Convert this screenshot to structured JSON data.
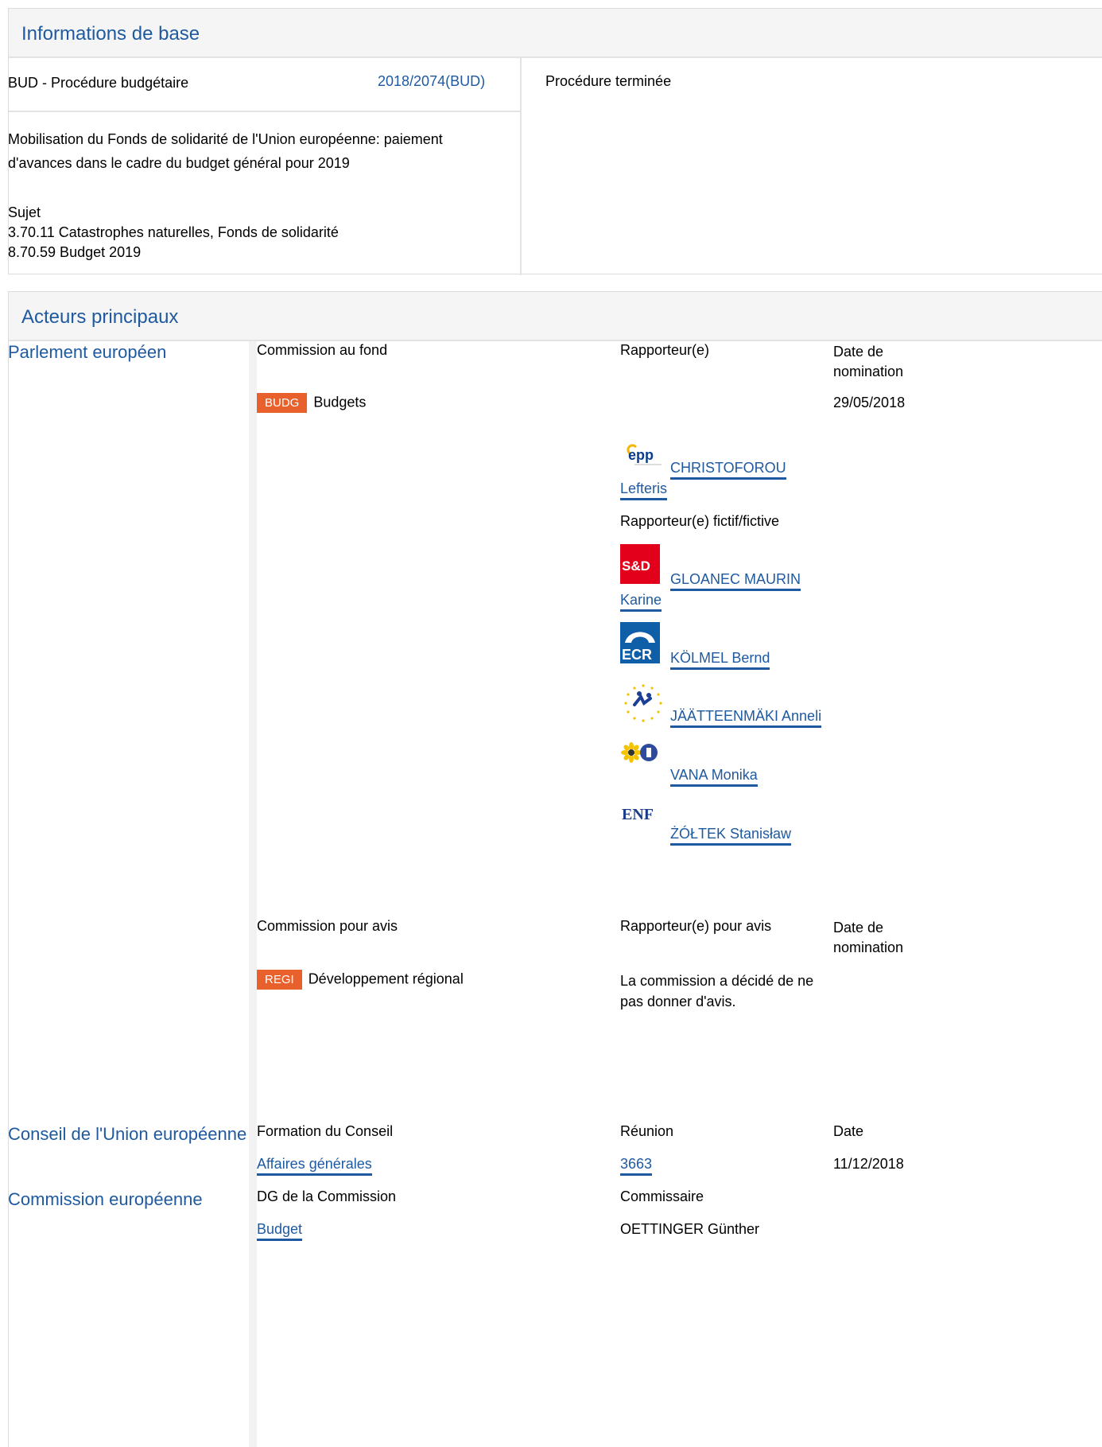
{
  "basic": {
    "header": "Informations de base",
    "procedure_type": "BUD - Procédure budgétaire",
    "procedure_ref": "2018/2074(BUD)",
    "status": "Procédure terminée",
    "title_line1": "Mobilisation du Fonds de solidarité de l'Union européenne: paiement",
    "title_line2": "d'avances dans le cadre du budget général pour 2019",
    "subject_label": "Sujet",
    "subjects": [
      "3.70.11 Catastrophes naturelles, Fonds de solidarité",
      "8.70.59 Budget 2019"
    ]
  },
  "actors": {
    "header": "Acteurs principaux",
    "parliament": {
      "label": "Parlement européen",
      "col_committee": "Commission au fond",
      "col_rapporteur": "Rapporteur(e)",
      "col_date_line1": "Date de",
      "col_date_line2": "nomination",
      "committee_badge": "BUDG",
      "committee_name": "Budgets",
      "committee_date": "29/05/2018",
      "rapporteur": {
        "first": "CHRISTOFOROU",
        "second": "Lefteris",
        "logo": "epp-logo",
        "logo_text": "epp"
      },
      "shadow_label": "Rapporteur(e) fictif/fictive",
      "shadows": [
        {
          "first": "GLOANEC MAURIN",
          "second": "Karine",
          "logo": "sd-logo",
          "logo_text": "S&D"
        },
        {
          "first": "KÖLMEL Bernd",
          "logo": "ecr-logo",
          "logo_text": "ECR"
        },
        {
          "first": "JÄÄTTEENMÄKI Anneli",
          "logo": "alde-logo"
        },
        {
          "first": "VANA Monika",
          "logo": "greens-logo"
        },
        {
          "first": "ŻÓŁTEK Stanisław",
          "logo": "enf-logo",
          "logo_text": "ENF"
        }
      ],
      "col_opinion": "Commission pour avis",
      "col_opinion_rapporteur": "Rapporteur(e) pour avis",
      "opinion_badge": "REGI",
      "opinion_name": "Développement régional",
      "opinion_note_line1": "La commission a décidé de ne",
      "opinion_note_line2": "pas donner d'avis."
    },
    "council": {
      "label": "Conseil de l'Union européenne",
      "col_formation": "Formation du Conseil",
      "col_meeting": "Réunion",
      "col_date": "Date",
      "formation": "Affaires générales",
      "meeting": "3663",
      "date": "11/12/2018"
    },
    "commission": {
      "label": "Commission européenne",
      "col_dg": "DG de la Commission",
      "col_commissioner": "Commissaire",
      "dg": "Budget",
      "commissioner": "OETTINGER Günther"
    }
  }
}
